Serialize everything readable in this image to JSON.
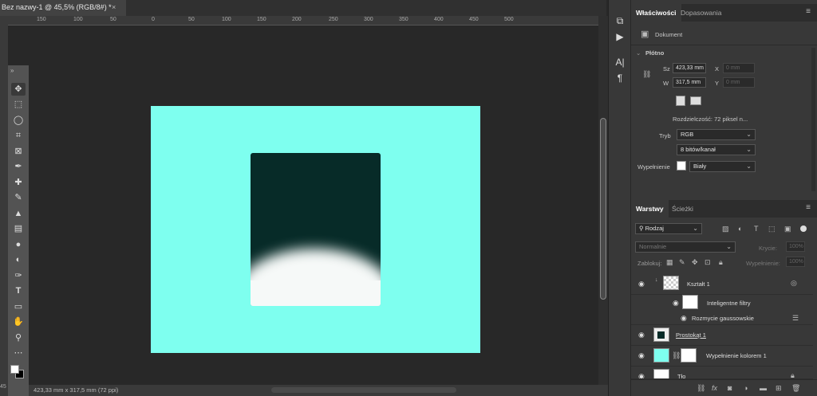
{
  "document": {
    "tab_title": "Bez nazwy-1 @ 45,5% (RGB/8#) *",
    "close_glyph": "×",
    "status_text": "423,33 mm x 317,5 mm (72 ppi)",
    "ruler_ticks": [
      "150",
      "100",
      "50",
      "0",
      "50",
      "100",
      "150",
      "200",
      "250",
      "300",
      "350",
      "400",
      "450",
      "500"
    ],
    "left_ruler_mark": "45",
    "artboard_color": "#7effef",
    "shape_color": "#072b28"
  },
  "toolbar": {
    "tools": [
      "move-tool",
      "marquee-tool",
      "lasso-tool",
      "crop-tool",
      "frame-tool",
      "eyedropper-tool",
      "healing-tool",
      "brush-tool",
      "stamp-tool",
      "gradient-tool",
      "blur-tool",
      "dodge-tool",
      "pen-tool",
      "type-tool",
      "rectangle-tool",
      "hand-tool",
      "zoom-tool",
      "more-tools"
    ]
  },
  "properties": {
    "tabs": [
      "Właściwości",
      "Dopasowania"
    ],
    "document_label": "Dokument",
    "section_canvas": "Płótno",
    "width_label": "Sz",
    "width_value": "423,33 mm",
    "height_label": "W",
    "height_value": "317,5 mm",
    "x_label": "X",
    "x_placeholder": "0 mm",
    "y_label": "Y",
    "y_placeholder": "0 mm",
    "resolution_text": "Rozdzielczość: 72 piksel n...",
    "mode_label": "Tryb",
    "mode_value": "RGB",
    "depth_value": "8 bitów/kanał",
    "fill_label": "Wypełnienie",
    "fill_value": "Biały"
  },
  "layers_panel": {
    "tabs": [
      "Warstwy",
      "Ścieżki"
    ],
    "filter_value": "Rodzaj",
    "blend_mode": "Normalnie",
    "opacity_label": "Krycie:",
    "opacity_value": "100%",
    "lock_label": "Zablokuj:",
    "fill_label": "Wypełnienie:",
    "fill_value": "100%",
    "layers": [
      {
        "name": "Kształt 1"
      },
      {
        "name": "Inteligentne filtry"
      },
      {
        "name": "Rozmycie gaussowskie"
      },
      {
        "name": "Prostokąt 1"
      },
      {
        "name": "Wypełnienie kolorem 1"
      },
      {
        "name": "Tło"
      }
    ]
  }
}
